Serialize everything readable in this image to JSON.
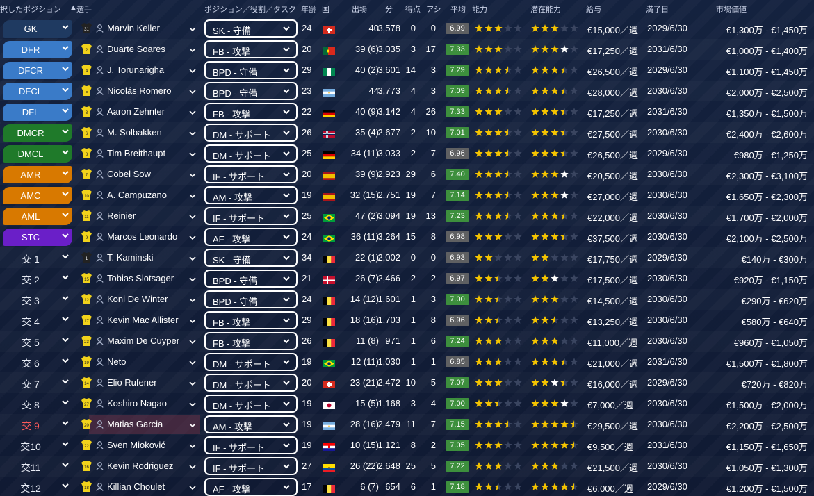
{
  "columns": {
    "position": "択したポジション",
    "player": "選手",
    "role": "ポジション／役割／タスク",
    "age": "年齢",
    "nat": "国",
    "apps": "出場",
    "mins": "分",
    "goals": "得点",
    "assists": "アシ",
    "avg": "平均",
    "ability": "能力",
    "potential": "潜在能力",
    "wage": "給与",
    "expiry": "満了日",
    "value": "市場価値"
  },
  "colors": {
    "accent_text": "#e8ecf5",
    "sub_highlight": "#ff5a5a",
    "rating_bg": "#3d8f3d",
    "rating_low": "#5f6062",
    "star": "#f5c400",
    "star_white": "#ffffff"
  },
  "players": [
    {
      "pos": "GK",
      "pos_type": "gk",
      "num": "31",
      "name": "Marvin Keller",
      "role": "SK - 守備",
      "age": "24",
      "flag": "ch",
      "apps": "40",
      "mins": "3,578",
      "goals": "0",
      "assists": "0",
      "rating": "6.99",
      "rating_color": "low",
      "ability": 3,
      "potential": 3,
      "wage": "€15,000／週",
      "expiry": "2029/6/30",
      "value": "€1,300万 - €1,450万"
    },
    {
      "pos": "DFR",
      "pos_type": "def",
      "num": "2",
      "name": "Duarte Soares",
      "role": "FB - 攻撃",
      "age": "20",
      "flag": "pt",
      "apps": "39 (6)",
      "mins": "3,035",
      "goals": "3",
      "assists": "17",
      "rating": "7.33",
      "rating_color": "green",
      "ability": 3,
      "potential": 4,
      "potential_white": true,
      "wage": "€17,250／週",
      "expiry": "2031/6/30",
      "value": "€1,000万 - €1,400万"
    },
    {
      "pos": "DFCR",
      "pos_type": "def",
      "num": "4",
      "name": "J. Torunarigha",
      "role": "BPD - 守備",
      "age": "29",
      "flag": "ng",
      "apps": "40 (2)",
      "mins": "3,601",
      "goals": "14",
      "assists": "3",
      "rating": "7.29",
      "rating_color": "green",
      "ability": 3.5,
      "potential": 3.5,
      "wage": "€26,500／週",
      "expiry": "2029/6/30",
      "value": "€1,100万 - €1,450万"
    },
    {
      "pos": "DFCL",
      "pos_type": "def",
      "num": "5",
      "name": "Nicolás Romero",
      "role": "BPD - 守備",
      "age": "23",
      "flag": "ar",
      "apps": "44",
      "mins": "3,773",
      "goals": "4",
      "assists": "3",
      "rating": "7.09",
      "rating_color": "green",
      "ability": 3.5,
      "potential": 3.5,
      "wage": "€28,000／週",
      "expiry": "2030/6/30",
      "value": "€2,000万 - €2,500万"
    },
    {
      "pos": "DFL",
      "pos_type": "def",
      "num": "3",
      "name": "Aaron Zehnter",
      "role": "FB - 攻撃",
      "age": "22",
      "flag": "de",
      "apps": "40 (9)",
      "mins": "3,142",
      "goals": "4",
      "assists": "26",
      "rating": "7.33",
      "rating_color": "green",
      "ability": 3,
      "potential": 3.5,
      "wage": "€17,250／週",
      "expiry": "2031/6/30",
      "value": "€1,350万 - €1,500万"
    },
    {
      "pos": "DMCR",
      "pos_type": "dm",
      "num": "6",
      "name": "M. Solbakken",
      "role": "DM - サポート",
      "age": "26",
      "flag": "no",
      "apps": "35 (4)",
      "mins": "2,677",
      "goals": "2",
      "assists": "10",
      "rating": "7.01",
      "rating_color": "green",
      "ability": 3.5,
      "potential": 3.5,
      "wage": "€27,500／週",
      "expiry": "2030/6/30",
      "value": "€2,400万 - €2,600万"
    },
    {
      "pos": "DMCL",
      "pos_type": "dm",
      "num": "8",
      "name": "Tim Breithaupt",
      "role": "DM - サポート",
      "age": "25",
      "flag": "de",
      "apps": "34 (11)",
      "mins": "3,033",
      "goals": "2",
      "assists": "7",
      "rating": "6.96",
      "rating_color": "low",
      "ability": 3.5,
      "potential": 3.5,
      "wage": "€26,500／週",
      "expiry": "2029/6/30",
      "value": "€980万 - €1,250万"
    },
    {
      "pos": "AMR",
      "pos_type": "am",
      "num": "7",
      "name": "Cobel Sow",
      "role": "IF - サポート",
      "age": "20",
      "flag": "es",
      "apps": "39 (9)",
      "mins": "2,923",
      "goals": "29",
      "assists": "6",
      "rating": "7.40",
      "rating_color": "green",
      "ability": 3.5,
      "potential": 4,
      "potential_white": true,
      "wage": "€20,500／週",
      "expiry": "2030/6/30",
      "value": "€2,300万 - €3,100万"
    },
    {
      "pos": "AMC",
      "pos_type": "am",
      "num": "10",
      "name": "A. Campuzano",
      "role": "AM - 攻撃",
      "age": "19",
      "flag": "es",
      "apps": "32 (15)",
      "mins": "2,751",
      "goals": "19",
      "assists": "7",
      "rating": "7.14",
      "rating_color": "green",
      "ability": 3.5,
      "potential": 4,
      "potential_white": true,
      "wage": "€27,000／週",
      "expiry": "2030/6/30",
      "value": "€1,650万 - €2,300万"
    },
    {
      "pos": "AML",
      "pos_type": "am",
      "num": "11",
      "name": "Reinier",
      "role": "IF - サポート",
      "age": "25",
      "flag": "br",
      "apps": "47 (2)",
      "mins": "3,094",
      "goals": "19",
      "assists": "13",
      "rating": "7.23",
      "rating_color": "green",
      "ability": 3.5,
      "potential": 3.5,
      "wage": "€22,000／週",
      "expiry": "2030/6/30",
      "value": "€1,700万 - €2,000万"
    },
    {
      "pos": "STC",
      "pos_type": "st",
      "num": "9",
      "name": "Marcos Leonardo",
      "role": "AF - 攻撃",
      "age": "24",
      "flag": "br",
      "apps": "36 (11)",
      "mins": "3,264",
      "goals": "15",
      "assists": "8",
      "rating": "6.98",
      "rating_color": "low",
      "ability": 3,
      "potential": 3.5,
      "wage": "€37,500／週",
      "expiry": "2030/6/30",
      "value": "€2,100万 - €2,500万"
    },
    {
      "pos": "交 1",
      "pos_type": "sub",
      "num": "1",
      "name": "T. Kaminski",
      "role": "SK - 守備",
      "age": "34",
      "flag": "be",
      "apps": "22 (1)",
      "mins": "2,002",
      "goals": "0",
      "assists": "0",
      "rating": "6.93",
      "rating_color": "low",
      "ability": 2,
      "potential": 2,
      "wage": "€17,750／週",
      "expiry": "2029/6/30",
      "value": "€140万 - €300万"
    },
    {
      "pos": "交 2",
      "pos_type": "sub",
      "num": "15",
      "name": "Tobias Slotsager",
      "role": "BPD - 守備",
      "age": "21",
      "flag": "dk",
      "apps": "26 (7)",
      "mins": "2,466",
      "goals": "2",
      "assists": "2",
      "rating": "6.97",
      "rating_color": "low",
      "ability": 2.5,
      "potential": 3,
      "potential_white": true,
      "wage": "€17,500／週",
      "expiry": "2030/6/30",
      "value": "€920万 - €1,150万"
    },
    {
      "pos": "交 3",
      "pos_type": "sub",
      "num": "12",
      "name": "Koni De Winter",
      "role": "BPD - 守備",
      "age": "24",
      "flag": "be",
      "apps": "14 (12)",
      "mins": "1,601",
      "goals": "1",
      "assists": "3",
      "rating": "7.00",
      "rating_color": "green",
      "ability": 2.5,
      "potential": 3,
      "wage": "€14,500／週",
      "expiry": "2030/6/30",
      "value": "€290万 - €620万"
    },
    {
      "pos": "交 4",
      "pos_type": "sub",
      "num": "17",
      "name": "Kevin Mac Allister",
      "role": "FB - 攻撃",
      "age": "29",
      "flag": "be",
      "apps": "18 (16)",
      "mins": "1,703",
      "goals": "1",
      "assists": "8",
      "rating": "6.96",
      "rating_color": "low",
      "ability": 2.5,
      "potential": 2.5,
      "wage": "€13,250／週",
      "expiry": "2030/6/30",
      "value": "€580万 - €640万"
    },
    {
      "pos": "交 5",
      "pos_type": "sub",
      "num": "23",
      "name": "Maxim De Cuyper",
      "role": "FB - 攻撃",
      "age": "26",
      "flag": "be",
      "apps": "11 (8)",
      "mins": "971",
      "goals": "1",
      "assists": "6",
      "rating": "7.24",
      "rating_color": "green",
      "ability": 3,
      "potential": 3,
      "wage": "€11,000／週",
      "expiry": "2030/6/30",
      "value": "€960万 - €1,050万"
    },
    {
      "pos": "交 6",
      "pos_type": "sub",
      "num": "19",
      "name": "Neto",
      "role": "DM - サポート",
      "age": "19",
      "flag": "br",
      "apps": "12 (11)",
      "mins": "1,030",
      "goals": "1",
      "assists": "1",
      "rating": "6.85",
      "rating_color": "low",
      "ability": 3,
      "potential": 3.5,
      "wage": "€21,000／週",
      "expiry": "2031/6/30",
      "value": "€1,500万 - €1,800万"
    },
    {
      "pos": "交 7",
      "pos_type": "sub",
      "num": "14",
      "name": "Elio Rufener",
      "role": "DM - サポート",
      "age": "20",
      "flag": "ch",
      "apps": "23 (21)",
      "mins": "2,472",
      "goals": "10",
      "assists": "5",
      "rating": "7.07",
      "rating_color": "green",
      "ability": 3,
      "potential": 3.5,
      "potential_white": true,
      "wage": "€16,000／週",
      "expiry": "2029/6/30",
      "value": "€720万 - €820万"
    },
    {
      "pos": "交 8",
      "pos_type": "sub",
      "num": "27",
      "name": "Koshiro Nagao",
      "role": "DM - サポート",
      "age": "19",
      "flag": "jp",
      "apps": "15 (5)",
      "mins": "1,168",
      "goals": "3",
      "assists": "4",
      "rating": "7.00",
      "rating_color": "green",
      "ability": 2.5,
      "potential": 4,
      "potential_white": true,
      "wage": "€7,000／週",
      "expiry": "2030/6/30",
      "value": "€1,500万 - €2,000万"
    },
    {
      "pos": "交 9",
      "pos_type": "sub",
      "pos_red": true,
      "highlight": true,
      "num": "20",
      "name": "Matias Garcia",
      "role": "AM - 攻撃",
      "age": "19",
      "flag": "ar",
      "apps": "28 (16)",
      "mins": "2,479",
      "goals": "11",
      "assists": "7",
      "rating": "7.15",
      "rating_color": "green",
      "ability": 3.5,
      "potential": 4.5,
      "wage": "€29,500／週",
      "expiry": "2030/6/30",
      "value": "€2,200万 - €2,500万"
    },
    {
      "pos": "交10",
      "pos_type": "sub",
      "num": "22",
      "name": "Sven Mioković",
      "role": "IF - サポート",
      "age": "19",
      "flag": "hr",
      "apps": "10 (15)",
      "mins": "1,121",
      "goals": "8",
      "assists": "2",
      "rating": "7.05",
      "rating_color": "green",
      "ability": 3,
      "potential": 4.5,
      "wage": "€9,500／週",
      "expiry": "2031/6/30",
      "value": "€1,150万 - €1,650万"
    },
    {
      "pos": "交11",
      "pos_type": "sub",
      "num": "16",
      "name": "Kevin Rodriguez",
      "role": "IF - サポート",
      "age": "27",
      "flag": "ec",
      "apps": "26 (22)",
      "mins": "2,648",
      "goals": "25",
      "assists": "5",
      "rating": "7.22",
      "rating_color": "green",
      "ability": 3,
      "potential": 3,
      "wage": "€21,500／週",
      "expiry": "2030/6/30",
      "value": "€1,050万 - €1,300万"
    },
    {
      "pos": "交12",
      "pos_type": "sub",
      "num": "18",
      "name": "Killian Choulet",
      "role": "AF - 攻撃",
      "age": "17",
      "flag": "be",
      "apps": "6 (7)",
      "mins": "654",
      "goals": "6",
      "assists": "1",
      "rating": "7.18",
      "rating_color": "green",
      "ability": 2.5,
      "potential": 4.5,
      "wage": "€6,000／週",
      "expiry": "2029/6/30",
      "value": "€1,200万 - €1,500万"
    }
  ]
}
